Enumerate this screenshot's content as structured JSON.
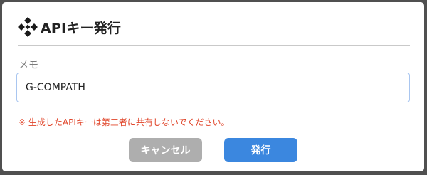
{
  "dialog": {
    "title": "APIキー発行",
    "logo_icon": "kintone-diamond-logo-icon",
    "memo_label": "メモ",
    "memo_value": "G-COMPATH",
    "notice": "※ 生成したAPIキーは第三者に共有しないでください。",
    "cancel_label": "キャンセル",
    "issue_label": "発行"
  },
  "colors": {
    "cancel_button": "#aeaeae",
    "issue_button": "#3b87df",
    "notice_text": "#e0452a",
    "input_border": "#a9c6f0"
  }
}
